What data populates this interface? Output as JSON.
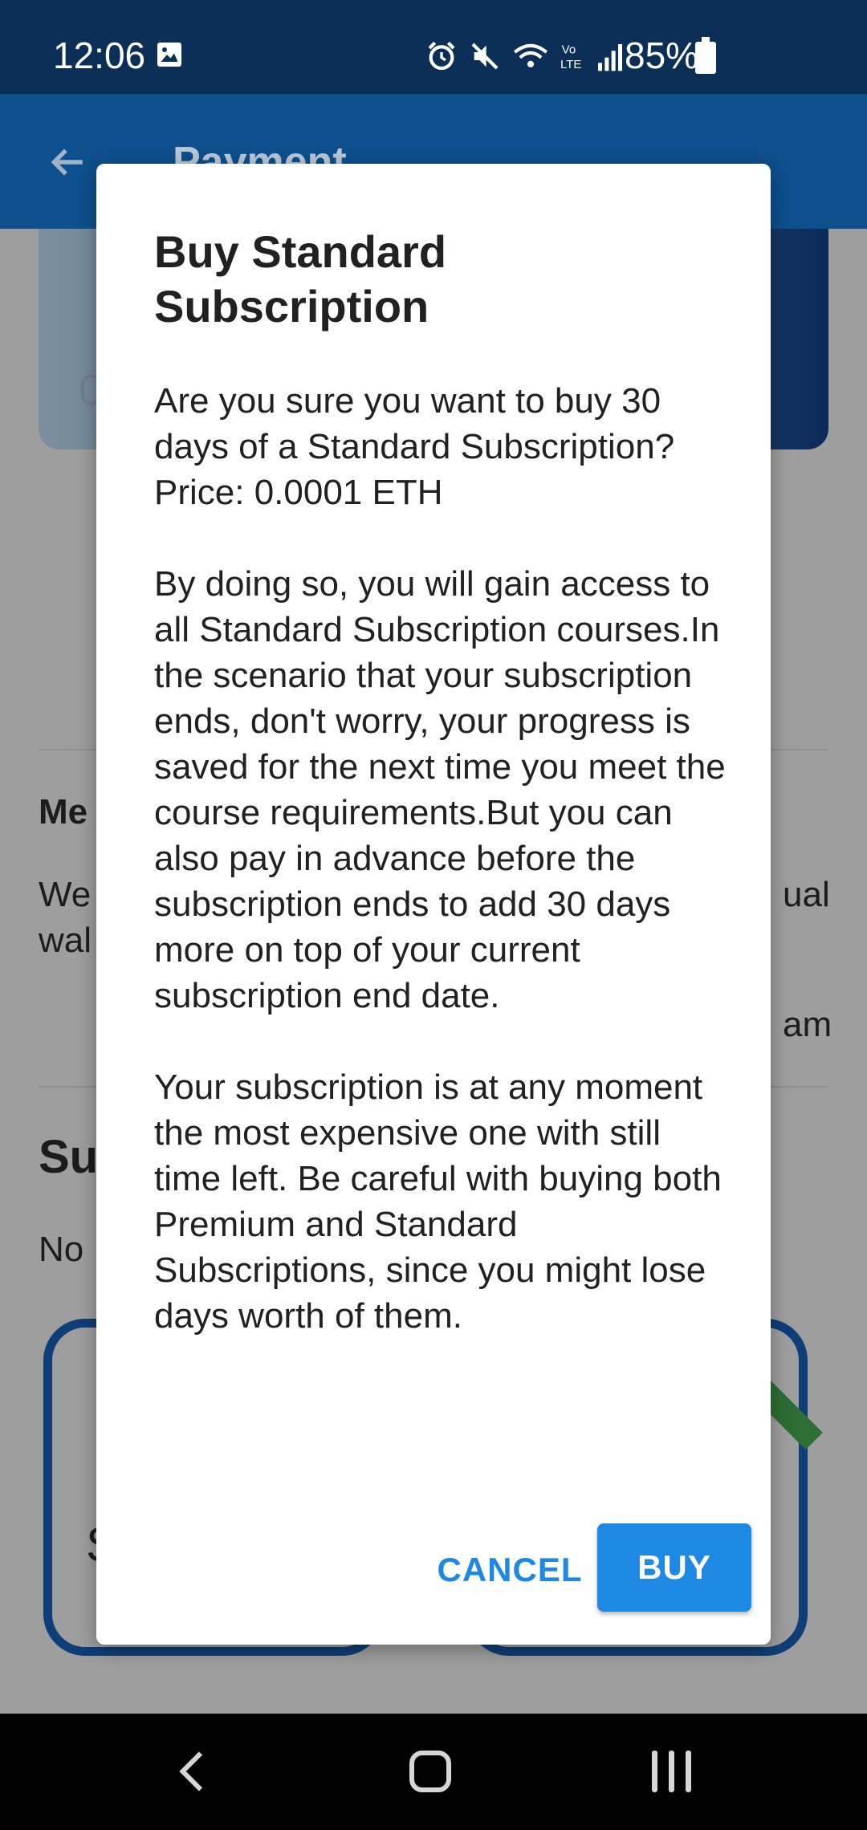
{
  "status_bar": {
    "time": "12:06",
    "battery": "85%",
    "icons": [
      "image-icon",
      "alarm-icon",
      "mute-icon",
      "wifi-icon",
      "volte-icon",
      "signal-icon",
      "battery-icon"
    ]
  },
  "app_bar": {
    "title": "Payment"
  },
  "background": {
    "card_digit": "0",
    "section1_heading_partial": "Me",
    "section1_line1_left": "We",
    "section1_line1_right": "ual",
    "section1_line2_left": "wal",
    "section1_line3_right": "am",
    "section2_heading_partial": "Su",
    "section2_text_partial": "No",
    "plan_card_letter": "S"
  },
  "dialog": {
    "title": "Buy Standard Subscription",
    "paragraphs": [
      "Are you sure you want to buy 30 days of a Standard Subscription? Price: 0.0001 ETH",
      "By doing so, you will gain access to all Standard Subscription courses.In the scenario that your subscription ends, don't worry, your progress is saved for the next time you meet the course requirements.But you can also pay in advance before the subscription ends to add 30 days more on top of your current subscription end date.",
      "Your subscription is at any moment the most expensive one with still time left. Be careful with buying both Premium and Standard Subscriptions, since you might lose days worth of them."
    ],
    "cancel_label": "CANCEL",
    "buy_label": "BUY"
  },
  "colors": {
    "accent": "#1e88e5",
    "status_bar": "#0b2f56",
    "app_bar": "#0e4f8d"
  }
}
